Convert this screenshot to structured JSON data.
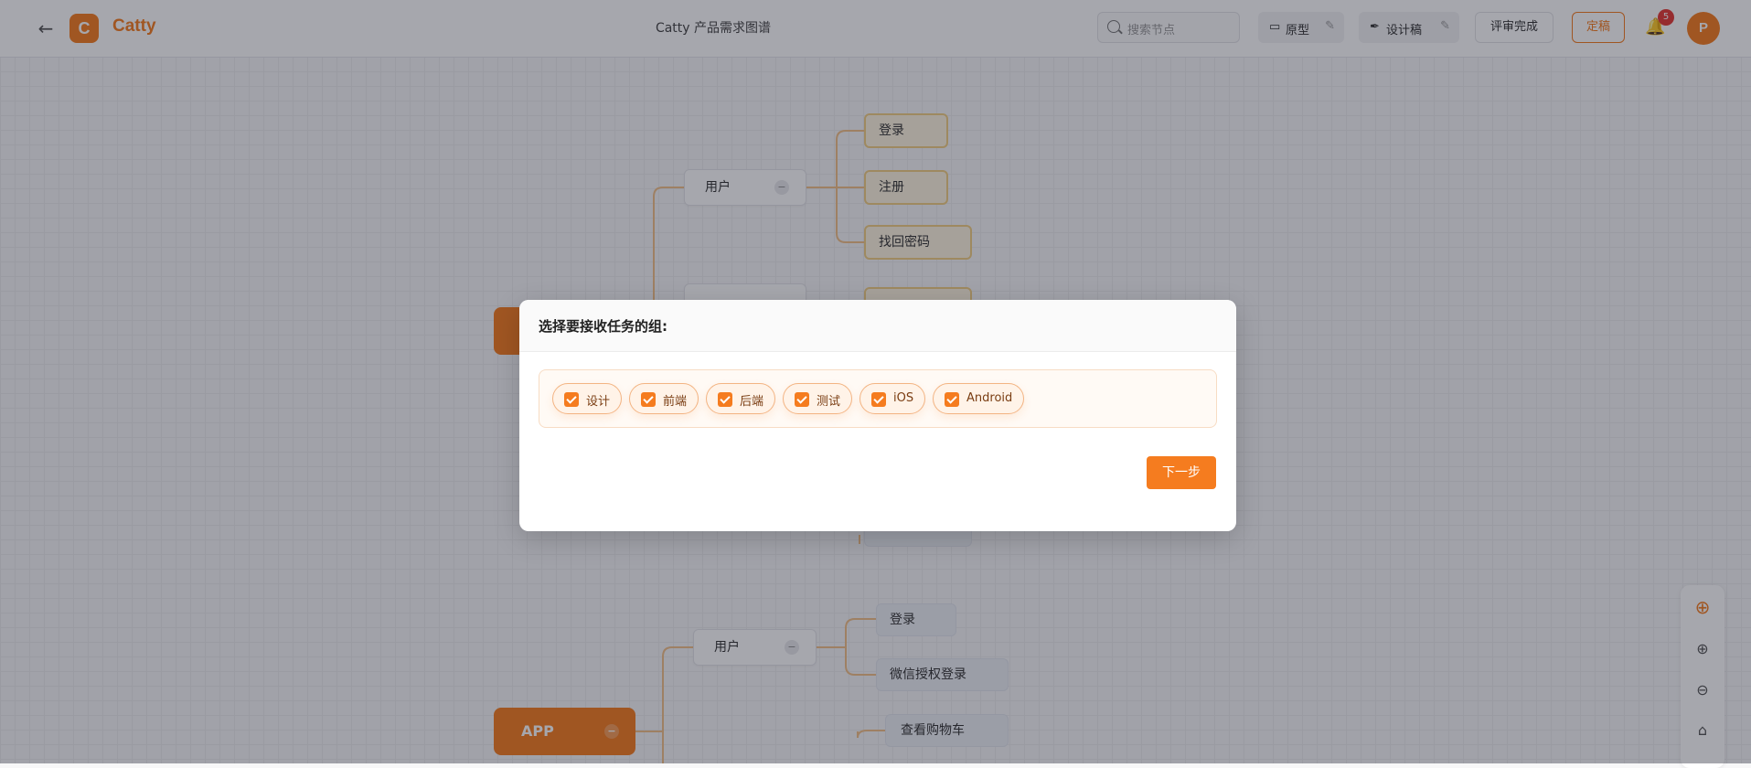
{
  "header": {
    "brand_letter": "C",
    "brand": "Catty",
    "doc_title": "Catty 产品需求图谱",
    "search_placeholder": "搜索节点",
    "tools": [
      {
        "label": "原型",
        "icon": "monitor-icon"
      },
      {
        "label": "设计稿",
        "icon": "pen-icon"
      }
    ],
    "review_label": "评审完成",
    "edit_label": "定稿",
    "notification_count": "5",
    "avatar_initial": "P"
  },
  "mindmap": {
    "groups": [
      {
        "label": "用户"
      },
      {
        "label": "用户"
      }
    ],
    "leaves_top": [
      "登录",
      "注册",
      "找回密码"
    ],
    "leaves_bottom": [
      "登录",
      "微信授权登录",
      "查看购物车"
    ],
    "root_app": "APP"
  },
  "dialog": {
    "title": "选择要接收任务的组:",
    "groups": [
      {
        "label": "设计",
        "checked": true
      },
      {
        "label": "前端",
        "checked": true
      },
      {
        "label": "后端",
        "checked": true
      },
      {
        "label": "测试",
        "checked": true
      },
      {
        "label": "iOS",
        "checked": true
      },
      {
        "label": "Android",
        "checked": true
      }
    ],
    "next_label": "下一步"
  },
  "colors": {
    "accent": "#f57c1f",
    "overlay": "rgba(20,24,40,0.38)"
  }
}
